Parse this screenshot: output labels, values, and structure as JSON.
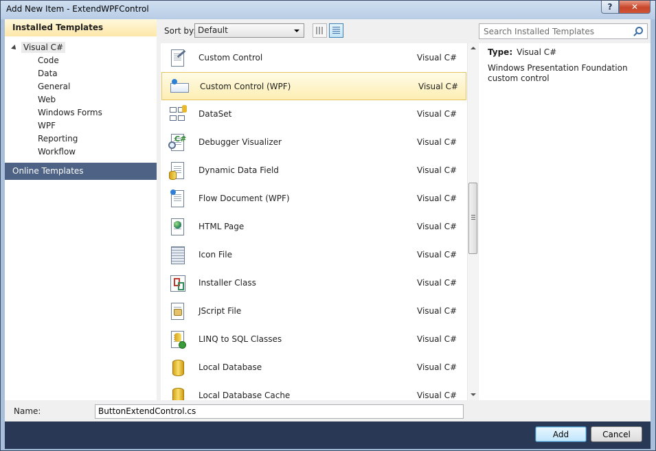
{
  "window": {
    "title": "Add New Item - ExtendWPFControl",
    "help_label": "?",
    "close_label": "✕"
  },
  "left": {
    "installed_header": "Installed Templates",
    "root": "Visual C#",
    "items": [
      "Code",
      "Data",
      "General",
      "Web",
      "Windows Forms",
      "WPF",
      "Reporting",
      "Workflow"
    ],
    "online_header": "Online Templates"
  },
  "toolbar": {
    "sort_label": "Sort by:",
    "sort_value": "Default"
  },
  "search": {
    "placeholder": "Search Installed Templates"
  },
  "templates": [
    {
      "name": "Custom Control",
      "lang": "Visual C#",
      "icon": "custom-control-icon"
    },
    {
      "name": "Custom Control (WPF)",
      "lang": "Visual C#",
      "icon": "wpf-control-icon"
    },
    {
      "name": "DataSet",
      "lang": "Visual C#",
      "icon": "dataset-icon"
    },
    {
      "name": "Debugger Visualizer",
      "lang": "Visual C#",
      "icon": "debugger-visualizer-icon"
    },
    {
      "name": "Dynamic Data Field",
      "lang": "Visual C#",
      "icon": "dynamic-data-field-icon"
    },
    {
      "name": "Flow Document (WPF)",
      "lang": "Visual C#",
      "icon": "flow-document-icon"
    },
    {
      "name": "HTML Page",
      "lang": "Visual C#",
      "icon": "html-page-icon"
    },
    {
      "name": "Icon File",
      "lang": "Visual C#",
      "icon": "icon-file-icon"
    },
    {
      "name": "Installer Class",
      "lang": "Visual C#",
      "icon": "installer-class-icon"
    },
    {
      "name": "JScript File",
      "lang": "Visual C#",
      "icon": "jscript-file-icon"
    },
    {
      "name": "LINQ to SQL Classes",
      "lang": "Visual C#",
      "icon": "linq-to-sql-icon"
    },
    {
      "name": "Local Database",
      "lang": "Visual C#",
      "icon": "local-database-icon"
    },
    {
      "name": "Local Database Cache",
      "lang": "Visual C#",
      "icon": "local-database-cache-icon"
    }
  ],
  "selected_index": 1,
  "details": {
    "type_label": "Type:",
    "type_value": "Visual C#",
    "description": "Windows Presentation Foundation custom control"
  },
  "name_field": {
    "label": "Name:",
    "value": "ButtonExtendControl.cs"
  },
  "buttons": {
    "add": "Add",
    "cancel": "Cancel"
  }
}
